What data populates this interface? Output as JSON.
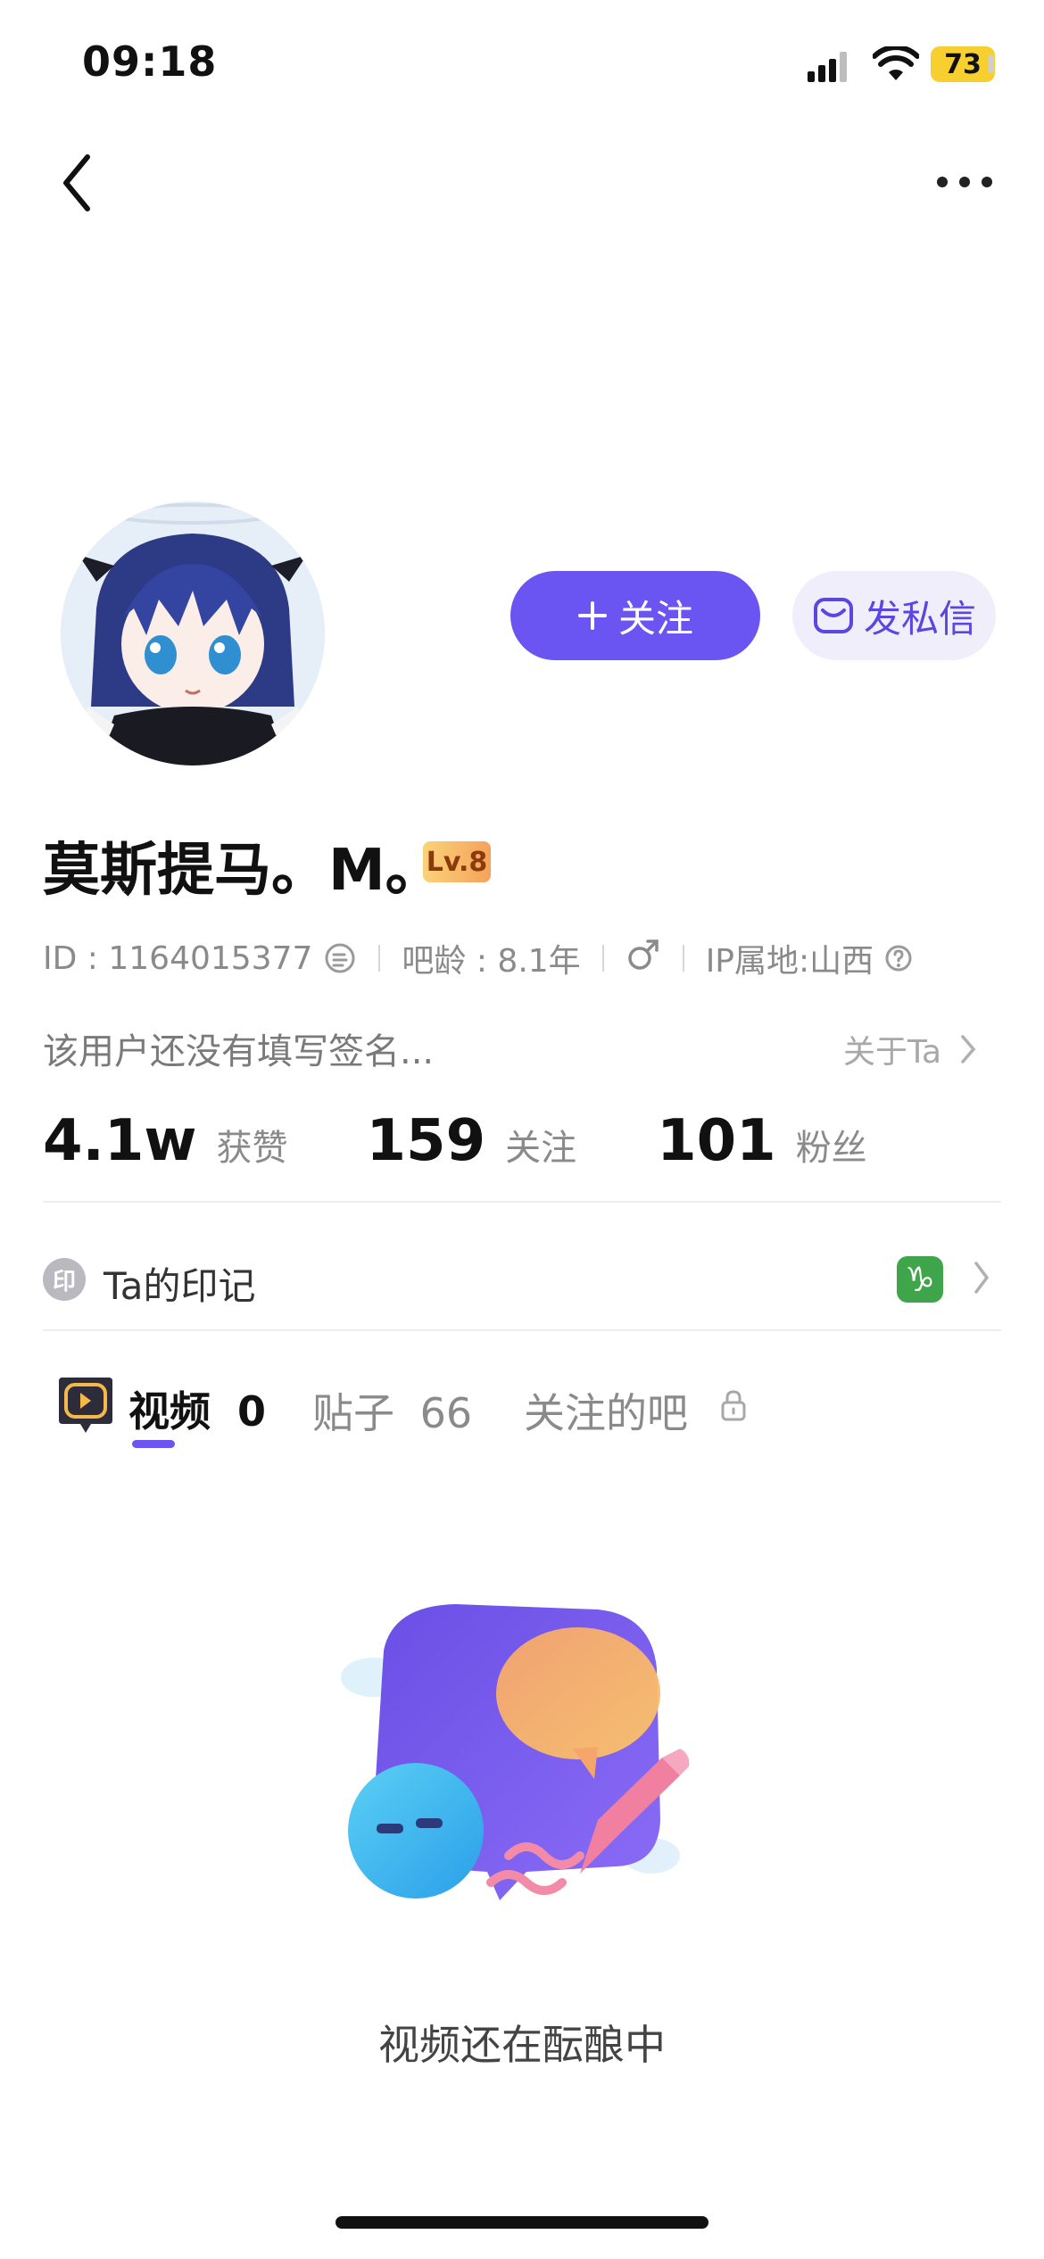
{
  "status_bar": {
    "time": "09:18",
    "battery": "73"
  },
  "profile": {
    "name": "莫斯提马。M。",
    "level": "Lv.8",
    "id_text": "ID : 1164015377",
    "bar_age": "吧龄 : 8.1年",
    "ip_location": "IP属地:山西",
    "signature": "该用户还没有填写签名...",
    "about_label": "关于Ta"
  },
  "actions": {
    "follow_label": "关注",
    "message_label": "发私信"
  },
  "stats": [
    {
      "value": "4.1w",
      "label": "获赞"
    },
    {
      "value": "159",
      "label": "关注"
    },
    {
      "value": "101",
      "label": "粉丝"
    }
  ],
  "mark": {
    "icon_text": "印",
    "label": "Ta的印记",
    "zodiac": "♑"
  },
  "tabs": [
    {
      "label": "视频",
      "count": "0"
    },
    {
      "label": "贴子",
      "count": "66"
    },
    {
      "label": "关注的吧"
    }
  ],
  "empty_state": {
    "text": "视频还在酝酿中"
  },
  "colors": {
    "accent": "#6b55f2",
    "battery": "#f7cf2e",
    "zodiac_bg": "#3ea54a"
  }
}
